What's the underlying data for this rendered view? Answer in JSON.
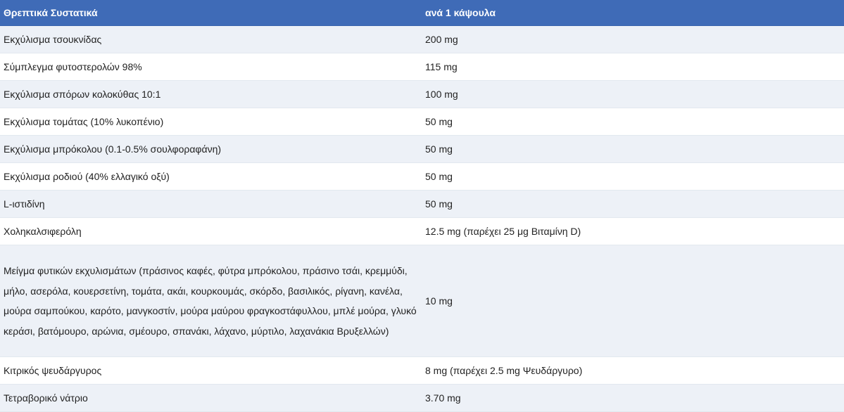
{
  "table": {
    "headers": [
      "Θρεπτικά Συστατικά",
      "ανά 1 κάψουλα"
    ],
    "rows": [
      {
        "ingredient": "Εκχύλισμα τσουκνίδας",
        "amount": "200 mg"
      },
      {
        "ingredient": "Σύμπλεγμα φυτοστερολών 98%",
        "amount": "115 mg"
      },
      {
        "ingredient": "Εκχύλισμα σπόρων κολοκύθας 10:1",
        "amount": "100 mg"
      },
      {
        "ingredient": "Εκχύλισμα τομάτας (10% λυκοπένιο)",
        "amount": "50 mg"
      },
      {
        "ingredient": "Εκχύλισμα μπρόκολου (0.1-0.5% σουλφοραφάνη)",
        "amount": "50 mg"
      },
      {
        "ingredient": "Εκχύλισμα ροδιού (40% ελλαγικό οξύ)",
        "amount": "50 mg"
      },
      {
        "ingredient": "L-ιστιδίνη",
        "amount": "50 mg"
      },
      {
        "ingredient": "Χοληκαλσιφερόλη",
        "amount": "12.5 mg (παρέχει 25 μg Βιταμίνη D)"
      },
      {
        "ingredient": "Μείγμα φυτικών εκχυλισμάτων (πράσινος καφές, φύτρα μπρόκολου, πράσινο τσάι, κρεμμύδι, μήλο, ασερόλα, κουερσετίνη, τομάτα, ακάι, κουρκουμάς, σκόρδο, βασιλικός, ρίγανη, κανέλα, μούρα σαμπούκου, καρότο, μανγκοστίν, μούρα μαύρου φραγκοστάφυλλου, μπλέ μούρα, γλυκό κεράσι, βατόμουρο, αρώνια, σμέουρο, σπανάκι, λάχανο, μύρτιλο, λαχανάκια Βρυξελλών)",
        "amount": "10 mg"
      },
      {
        "ingredient": "Κιτρικός ψευδάργυρος",
        "amount": "8 mg (παρέχει 2.5 mg Ψευδάργυρο)"
      },
      {
        "ingredient": "Τετραβορικό νάτριο",
        "amount": "3.70 mg"
      }
    ]
  }
}
